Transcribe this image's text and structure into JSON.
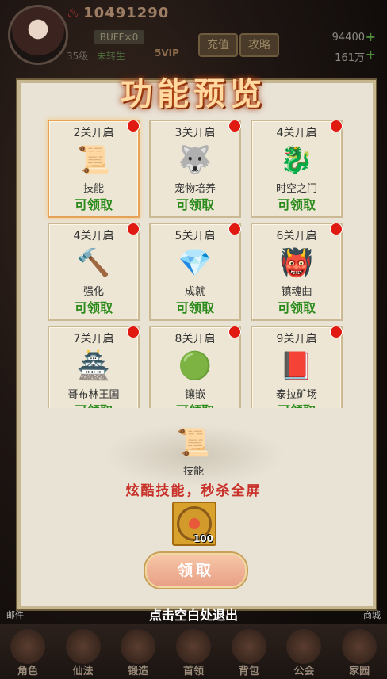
{
  "hud": {
    "power": "10491290",
    "vip_level": "35级",
    "rebirth": "未转生",
    "buff": "BUFF×0",
    "svip": "5VIP",
    "btn_recharge": "充值",
    "btn_guide": "攻略",
    "currency1": "94400",
    "currency2": "161万",
    "tab_mail": "邮件",
    "tab_store": "商城"
  },
  "modal": {
    "title": "功能预览",
    "cards": [
      {
        "level": "2关开启",
        "name": "技能",
        "status": "可领取",
        "icon": "book-scroll-icon"
      },
      {
        "level": "3关开启",
        "name": "宠物培养",
        "status": "可领取",
        "icon": "pet-icon"
      },
      {
        "level": "4关开启",
        "name": "时空之门",
        "status": "可领取",
        "icon": "portal-beast-icon"
      },
      {
        "level": "4关开启",
        "name": "强化",
        "status": "可领取",
        "icon": "hammer-icon"
      },
      {
        "level": "5关开启",
        "name": "成就",
        "status": "可领取",
        "icon": "crystal-icon"
      },
      {
        "level": "6关开启",
        "name": "镇魂曲",
        "status": "可领取",
        "icon": "demon-icon"
      },
      {
        "level": "7关开启",
        "name": "哥布林王国",
        "status": "可领取",
        "icon": "pagoda-icon"
      },
      {
        "level": "8关开启",
        "name": "镶嵌",
        "status": "可领取",
        "icon": "orb-icon"
      },
      {
        "level": "9关开启",
        "name": "泰拉矿场",
        "status": "可领取",
        "icon": "mine-scroll-icon"
      }
    ],
    "detail": {
      "name": "技能",
      "description": "炫酷技能，秒杀全屏",
      "reward_qty": "100",
      "claim_label": "领取"
    },
    "exit_hint": "点击空白处退出"
  },
  "bottom_nav": [
    "角色",
    "仙法",
    "锻造",
    "首领",
    "背包",
    "公会",
    "家园"
  ]
}
